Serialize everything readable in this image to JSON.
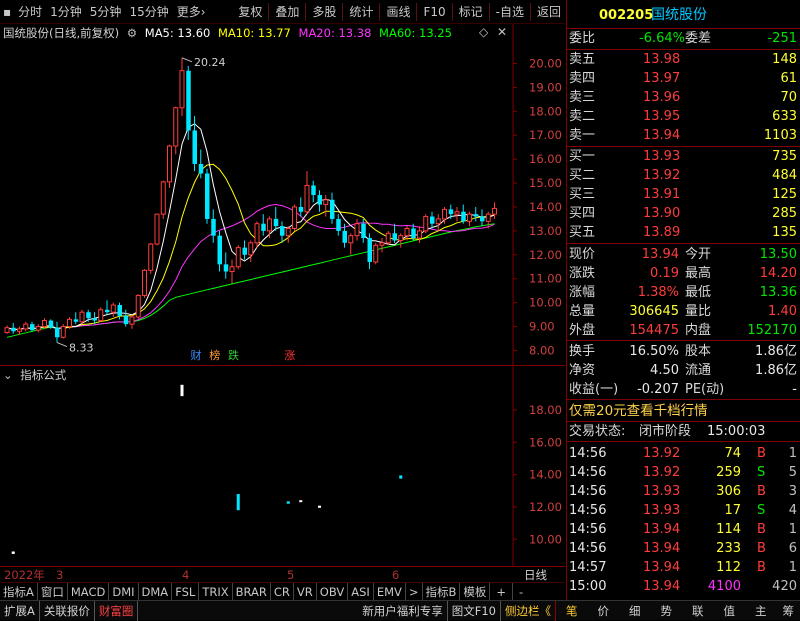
{
  "toolbar": {
    "left": [
      "分时",
      "1分钟",
      "5分钟",
      "15分钟",
      "更多"
    ],
    "more_arrow": "›",
    "right": [
      "复权",
      "叠加",
      "多股",
      "统计",
      "画线",
      "F10",
      "标记",
      "-自选",
      "返回"
    ]
  },
  "legend": {
    "title": "国统股份(日线,前复权)",
    "ma5": "MA5: 13.60",
    "ma10": "MA10: 13.77",
    "ma20": "MA20: 13.38",
    "ma60": "MA60: 13.25",
    "colors": {
      "ma5": "#ffffff",
      "ma10": "#ffff00",
      "ma20": "#ff33ff",
      "ma60": "#00ff00"
    }
  },
  "price_axis": {
    "ticks": [
      "20.00",
      "19.00",
      "18.00",
      "17.00",
      "16.00",
      "15.00",
      "14.00",
      "13.00",
      "12.00",
      "11.00",
      "10.00",
      "9.00",
      "8.00"
    ]
  },
  "annotations": {
    "high": "20.24",
    "low": "8.33",
    "events": [
      {
        "text": "财",
        "color": "#3c8cff",
        "xi": 30
      },
      {
        "text": "榜",
        "color": "#ff9933",
        "xi": 33
      },
      {
        "text": "跌",
        "color": "#33cc33",
        "xi": 36
      },
      {
        "text": "涨",
        "color": "#ff3333",
        "xi": 45
      }
    ]
  },
  "indicator": {
    "title": "指标公式",
    "ticks": [
      "18.00",
      "16.00",
      "14.00",
      "12.00",
      "10.00"
    ]
  },
  "date_axis": [
    "2022年",
    "3",
    "4",
    "5",
    "6"
  ],
  "ind_tabs": [
    "指标A",
    "窗口",
    "MACD",
    "DMI",
    "DMA",
    "FSL",
    "TRIX",
    "BRAR",
    "CR",
    "VR",
    "OBV",
    "ASI",
    "EMV",
    ">",
    "指标B",
    "模板",
    "+",
    "-"
  ],
  "right_scroll_label": "日线",
  "bottom_bar": {
    "left": [
      "扩展A",
      "关联报价",
      "财富圈"
    ],
    "right": [
      "新用户福利专享",
      "图文F10",
      "侧边栏《"
    ],
    "side": [
      "笔",
      "价",
      "细",
      "势",
      "联",
      "值",
      "主",
      "筹"
    ]
  },
  "stock": {
    "code": "002205",
    "name": "国统股份"
  },
  "weibi": {
    "label": "委比",
    "value": "-6.64%",
    "label2": "委差",
    "value2": "-251"
  },
  "asks": [
    {
      "label": "卖五",
      "price": "13.98",
      "vol": "148"
    },
    {
      "label": "卖四",
      "price": "13.97",
      "vol": "61"
    },
    {
      "label": "卖三",
      "price": "13.96",
      "vol": "70"
    },
    {
      "label": "卖二",
      "price": "13.95",
      "vol": "633"
    },
    {
      "label": "卖一",
      "price": "13.94",
      "vol": "1103"
    }
  ],
  "bids": [
    {
      "label": "买一",
      "price": "13.93",
      "vol": "735"
    },
    {
      "label": "买二",
      "price": "13.92",
      "vol": "484"
    },
    {
      "label": "买三",
      "price": "13.91",
      "vol": "125"
    },
    {
      "label": "买四",
      "price": "13.90",
      "vol": "285"
    },
    {
      "label": "买五",
      "price": "13.89",
      "vol": "135"
    }
  ],
  "quote": [
    {
      "l1": "现价",
      "v1": "13.94",
      "c1": "red",
      "l2": "今开",
      "v2": "13.50",
      "c2": "green"
    },
    {
      "l1": "涨跌",
      "v1": "0.19",
      "c1": "red",
      "l2": "最高",
      "v2": "14.20",
      "c2": "red"
    },
    {
      "l1": "涨幅",
      "v1": "1.38%",
      "c1": "red",
      "l2": "最低",
      "v2": "13.36",
      "c2": "green"
    },
    {
      "l1": "总量",
      "v1": "306645",
      "c1": "yellow",
      "l2": "量比",
      "v2": "1.40",
      "c2": "red"
    },
    {
      "l1": "外盘",
      "v1": "154475",
      "c1": "red",
      "l2": "内盘",
      "v2": "152170",
      "c2": "green"
    }
  ],
  "fin": [
    {
      "l1": "换手",
      "v1": "16.50%",
      "l2": "股本",
      "v2": "1.86亿"
    },
    {
      "l1": "净资",
      "v1": "4.50",
      "l2": "流通",
      "v2": "1.86亿"
    },
    {
      "l1": "收益(一)",
      "v1": "-0.207",
      "l2": "PE(动)",
      "v2": "-"
    }
  ],
  "promo": "仅需20元查看千档行情",
  "trade_status": {
    "label": "交易状态:",
    "value": "闭市阶段",
    "time": "15:00:03"
  },
  "ticks": [
    {
      "t": "14:56",
      "p": "13.92",
      "v": "74",
      "s": "B",
      "n": "1"
    },
    {
      "t": "14:56",
      "p": "13.92",
      "v": "259",
      "s": "S",
      "n": "5"
    },
    {
      "t": "14:56",
      "p": "13.93",
      "v": "306",
      "s": "B",
      "n": "3"
    },
    {
      "t": "14:56",
      "p": "13.93",
      "v": "17",
      "s": "S",
      "n": "4"
    },
    {
      "t": "14:56",
      "p": "13.94",
      "v": "114",
      "s": "B",
      "n": "1"
    },
    {
      "t": "14:56",
      "p": "13.94",
      "v": "233",
      "s": "B",
      "n": "6"
    },
    {
      "t": "14:57",
      "p": "13.94",
      "v": "112",
      "s": "B",
      "n": "1"
    },
    {
      "t": "15:00",
      "p": "13.94",
      "v": "4100",
      "s": "",
      "n": "420"
    }
  ],
  "chart_data": {
    "type": "candlestick",
    "candles": [
      [
        8.75,
        9.05,
        8.7,
        8.95
      ],
      [
        8.95,
        9.15,
        8.7,
        8.8
      ],
      [
        8.8,
        9.0,
        8.65,
        8.9
      ],
      [
        8.9,
        9.2,
        8.8,
        9.1
      ],
      [
        9.1,
        9.2,
        8.8,
        8.85
      ],
      [
        8.85,
        9.1,
        8.75,
        9.0
      ],
      [
        9.0,
        9.35,
        8.9,
        9.25
      ],
      [
        9.25,
        9.3,
        8.9,
        8.95
      ],
      [
        8.95,
        9.2,
        8.33,
        8.55
      ],
      [
        8.55,
        9.1,
        8.5,
        9.0
      ],
      [
        9.0,
        9.4,
        8.9,
        9.3
      ],
      [
        9.3,
        9.6,
        9.1,
        9.2
      ],
      [
        9.2,
        9.7,
        9.1,
        9.6
      ],
      [
        9.6,
        9.7,
        9.2,
        9.35
      ],
      [
        9.35,
        9.6,
        9.1,
        9.25
      ],
      [
        9.25,
        9.8,
        9.2,
        9.7
      ],
      [
        9.7,
        10.1,
        9.5,
        9.6
      ],
      [
        9.6,
        10.0,
        9.4,
        9.9
      ],
      [
        9.9,
        10.0,
        9.3,
        9.45
      ],
      [
        9.45,
        9.7,
        9.0,
        9.1
      ],
      [
        9.1,
        9.5,
        8.9,
        9.4
      ],
      [
        9.4,
        10.35,
        9.3,
        10.3
      ],
      [
        10.3,
        11.4,
        10.2,
        11.35
      ],
      [
        11.35,
        12.5,
        11.2,
        12.45
      ],
      [
        12.45,
        13.7,
        12.4,
        13.7
      ],
      [
        13.7,
        15.1,
        13.5,
        15.05
      ],
      [
        15.05,
        16.6,
        14.8,
        16.55
      ],
      [
        16.55,
        18.2,
        16.2,
        18.15
      ],
      [
        18.15,
        20.24,
        17.8,
        19.7
      ],
      [
        19.7,
        19.9,
        16.8,
        17.2
      ],
      [
        17.2,
        17.8,
        15.5,
        15.8
      ],
      [
        15.8,
        16.4,
        15.2,
        15.4
      ],
      [
        15.4,
        15.6,
        13.3,
        13.5
      ],
      [
        13.5,
        13.9,
        12.5,
        12.8
      ],
      [
        12.8,
        13.0,
        11.3,
        11.6
      ],
      [
        11.6,
        12.1,
        11.0,
        11.3
      ],
      [
        11.3,
        11.8,
        10.8,
        11.5
      ],
      [
        11.5,
        12.4,
        11.4,
        12.3
      ],
      [
        12.3,
        12.6,
        11.8,
        12.0
      ],
      [
        12.0,
        12.6,
        11.7,
        12.5
      ],
      [
        12.5,
        13.4,
        12.3,
        13.3
      ],
      [
        13.3,
        13.7,
        12.8,
        13.0
      ],
      [
        13.0,
        13.6,
        12.7,
        13.5
      ],
      [
        13.5,
        14.0,
        13.0,
        13.2
      ],
      [
        13.2,
        13.4,
        12.5,
        12.8
      ],
      [
        12.8,
        13.2,
        12.5,
        13.1
      ],
      [
        13.1,
        14.1,
        13.0,
        14.0
      ],
      [
        14.0,
        14.4,
        13.6,
        13.8
      ],
      [
        13.8,
        15.5,
        13.7,
        14.9
      ],
      [
        14.9,
        15.1,
        14.2,
        14.5
      ],
      [
        14.5,
        14.7,
        13.8,
        14.1
      ],
      [
        14.1,
        14.5,
        13.6,
        14.3
      ],
      [
        14.3,
        14.6,
        13.3,
        13.5
      ],
      [
        13.5,
        13.7,
        12.8,
        13.0
      ],
      [
        13.0,
        13.3,
        12.3,
        12.5
      ],
      [
        12.5,
        12.9,
        12.0,
        12.8
      ],
      [
        12.8,
        13.5,
        12.6,
        13.3
      ],
      [
        13.3,
        13.5,
        12.5,
        12.7
      ],
      [
        12.7,
        12.9,
        11.4,
        11.7
      ],
      [
        11.7,
        12.5,
        11.6,
        12.4
      ],
      [
        12.4,
        12.7,
        12.1,
        12.5
      ],
      [
        12.5,
        13.0,
        12.4,
        12.9
      ],
      [
        12.9,
        13.3,
        12.5,
        12.6
      ],
      [
        12.6,
        12.9,
        12.3,
        12.8
      ],
      [
        12.8,
        13.2,
        12.6,
        13.1
      ],
      [
        13.1,
        13.3,
        12.6,
        12.7
      ],
      [
        12.7,
        13.2,
        12.5,
        13.0
      ],
      [
        13.0,
        13.7,
        12.9,
        13.6
      ],
      [
        13.6,
        13.8,
        13.1,
        13.3
      ],
      [
        13.3,
        13.7,
        13.0,
        13.5
      ],
      [
        13.5,
        14.0,
        13.3,
        13.9
      ],
      [
        13.9,
        14.1,
        13.5,
        13.7
      ],
      [
        13.7,
        14.0,
        13.4,
        13.8
      ],
      [
        13.8,
        14.1,
        13.3,
        13.4
      ],
      [
        13.4,
        13.8,
        13.2,
        13.7
      ],
      [
        13.7,
        14.0,
        13.4,
        13.6
      ],
      [
        13.6,
        13.9,
        13.2,
        13.4
      ],
      [
        13.4,
        13.8,
        13.1,
        13.7
      ],
      [
        13.7,
        14.2,
        13.5,
        13.94
      ]
    ],
    "ylim": [
      7.6,
      20.9
    ],
    "indicator_ylim": [
      8.6,
      19.6
    ],
    "indicator_marks": [
      {
        "xi": 1,
        "y0": 9.1,
        "y1": 9.25,
        "color": "#ffffff"
      },
      {
        "xi": 28,
        "y0": 18.85,
        "y1": 19.55,
        "color": "#ffffff"
      },
      {
        "xi": 37,
        "y0": 11.8,
        "y1": 12.8,
        "color": "#00e8ff"
      },
      {
        "xi": 45,
        "y0": 12.2,
        "y1": 12.35,
        "color": "#00e8ff"
      },
      {
        "xi": 47,
        "y0": 12.3,
        "y1": 12.42,
        "color": "#ffffff"
      },
      {
        "xi": 50,
        "y0": 11.95,
        "y1": 12.08,
        "color": "#ffffff"
      },
      {
        "xi": 63,
        "y0": 13.75,
        "y1": 13.95,
        "color": "#00e8ff"
      }
    ]
  }
}
